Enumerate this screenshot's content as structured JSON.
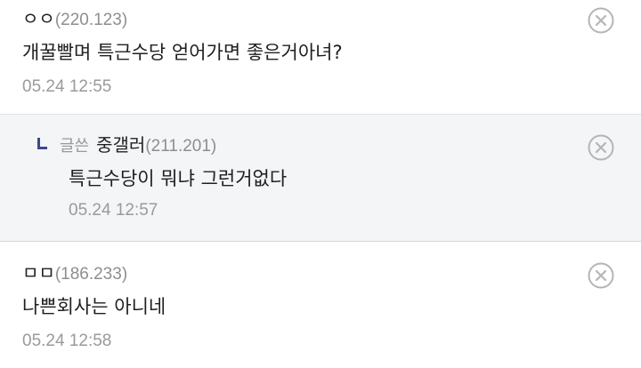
{
  "comments": [
    {
      "nickname": "ㅇㅇ",
      "ip": "(220.123)",
      "body": "개꿀빨며 특근수당 얻어가면 좋은거아녀?",
      "date": "05.24 12:55"
    },
    {
      "writer_tag": "글쓴",
      "nickname": "중갤러",
      "ip": "(211.201)",
      "body": "특근수당이 뭐냐 그런거없다",
      "date": "05.24 12:57"
    },
    {
      "nickname": "ㅁㅁ",
      "ip": "(186.233)",
      "body": "나쁜회사는 아니네",
      "date": "05.24 12:58"
    }
  ],
  "icons": {
    "delete": "close-circle-icon",
    "reply": "reply-arrow-icon"
  },
  "colors": {
    "reply_bg": "#f4f5f7",
    "reply_mark": "#3b4890",
    "meta_gray": "#9a9a9a"
  }
}
